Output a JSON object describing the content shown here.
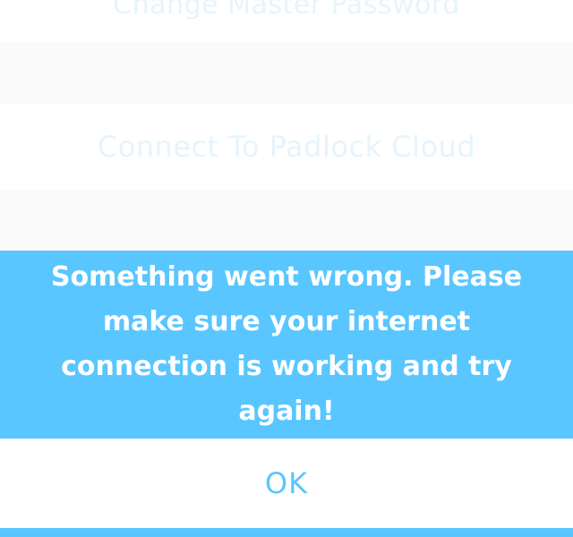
{
  "settings": {
    "change_master_password_label": "Change Master Password",
    "connect_cloud_label": "Connect To Padlock Cloud"
  },
  "dialog": {
    "message": "Something went wrong. Please make sure your internet connection is working and try again!",
    "ok_label": "OK"
  },
  "colors": {
    "accent": "#59c6ff",
    "background": "#ffffff",
    "faded_text": "#e6f4fc"
  }
}
